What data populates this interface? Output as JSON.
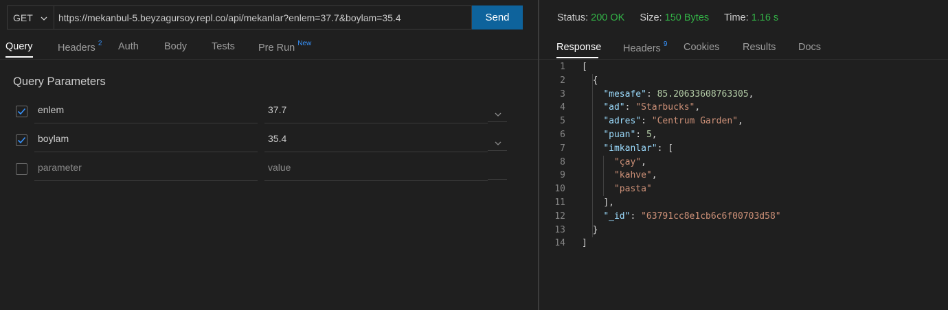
{
  "request": {
    "method": "GET",
    "url": "https://mekanbul-5.beyzagursoy.repl.co/api/mekanlar?enlem=37.7&boylam=35.4",
    "send_label": "Send"
  },
  "request_tabs": [
    {
      "label": "Query",
      "badge": ""
    },
    {
      "label": "Headers",
      "badge": "2"
    },
    {
      "label": "Auth",
      "badge": ""
    },
    {
      "label": "Body",
      "badge": ""
    },
    {
      "label": "Tests",
      "badge": ""
    },
    {
      "label": "Pre Run",
      "badge": "New"
    }
  ],
  "query": {
    "title": "Query Parameters",
    "params": [
      {
        "name": "enlem",
        "value": "37.7",
        "checked": true
      },
      {
        "name": "boylam",
        "value": "35.4",
        "checked": true
      }
    ],
    "new_row": {
      "name_placeholder": "parameter",
      "value_placeholder": "value",
      "checked": false
    }
  },
  "response_status": {
    "status_label": "Status:",
    "status_value": "200 OK",
    "size_label": "Size:",
    "size_value": "150 Bytes",
    "time_label": "Time:",
    "time_value": "1.16 s"
  },
  "response_tabs": [
    {
      "label": "Response",
      "badge": ""
    },
    {
      "label": "Headers",
      "badge": "9"
    },
    {
      "label": "Cookies",
      "badge": ""
    },
    {
      "label": "Results",
      "badge": ""
    },
    {
      "label": "Docs",
      "badge": ""
    }
  ],
  "response_body": {
    "line_numbers": [
      "1",
      "2",
      "3",
      "4",
      "5",
      "6",
      "7",
      "8",
      "9",
      "10",
      "11",
      "12",
      "13",
      "14"
    ],
    "lines": [
      "[",
      "  {",
      "    \"mesafe\": 85.20633608763305,",
      "    \"ad\": \"Starbucks\",",
      "    \"adres\": \"Centrum Garden\",",
      "    \"puan\": 5,",
      "    \"imkanlar\": [",
      "      \"çay\",",
      "      \"kahve\",",
      "      \"pasta\"",
      "    ],",
      "    \"_id\": \"63791cc8e1cb6c6f00703d58\"",
      "  }",
      "]"
    ]
  },
  "colors": {
    "accent": "#0e639c",
    "status_ok": "#33b347",
    "badge": "#3794ff"
  }
}
